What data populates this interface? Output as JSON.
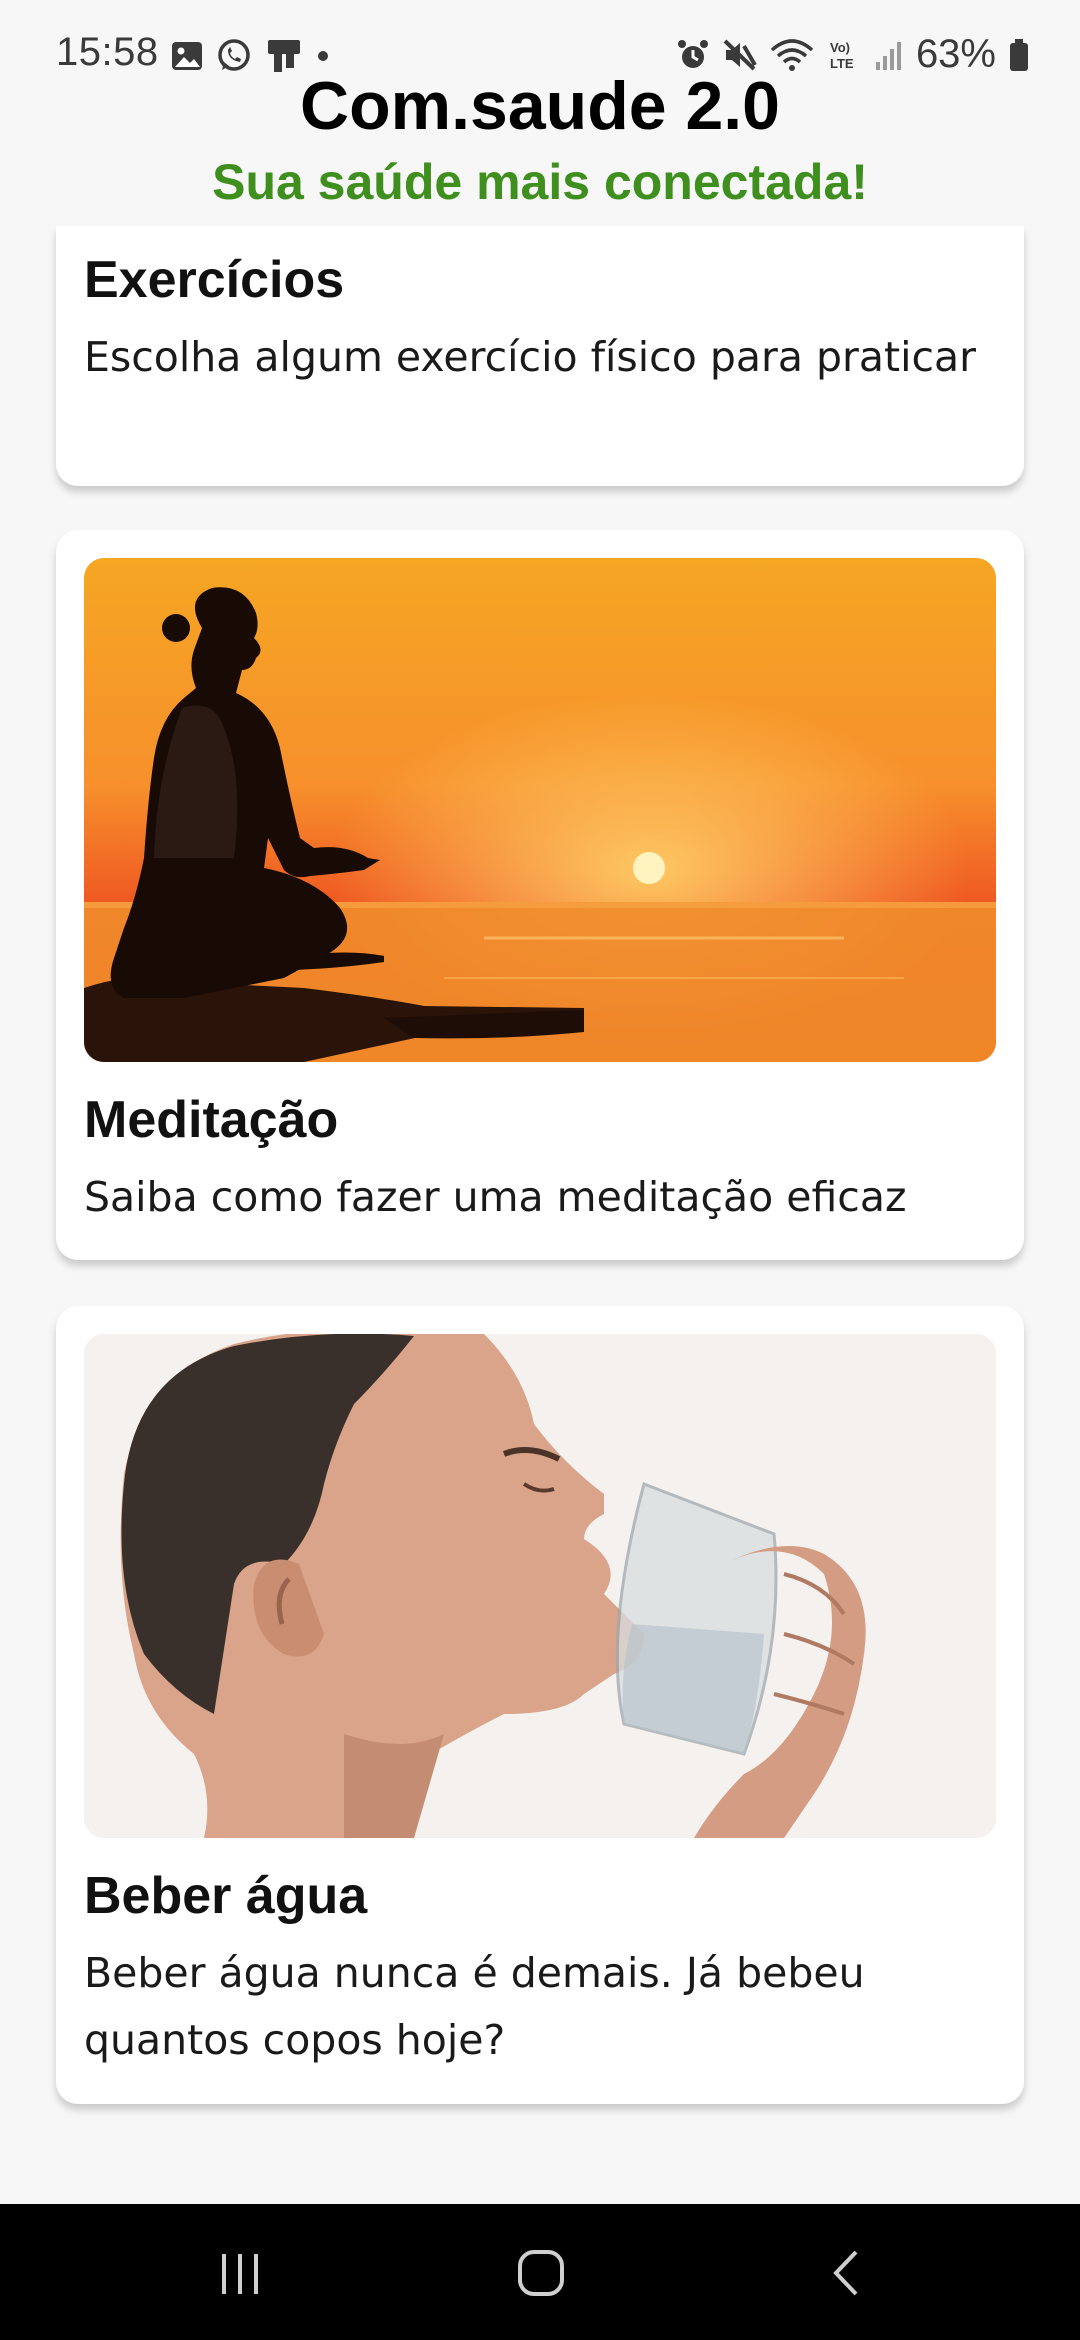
{
  "status": {
    "time": "15:58",
    "battery": "63%",
    "left_icons": [
      "image-icon",
      "whatsapp-icon",
      "sim-icon",
      "dot-icon"
    ],
    "right_icons": [
      "alarm-icon",
      "mute-icon",
      "wifi-icon",
      "volte-icon",
      "signal-icon",
      "battery-icon"
    ]
  },
  "header": {
    "title": "Com.saude 2.0",
    "subtitle": "Sua saúde mais conectada!"
  },
  "cards": [
    {
      "title": "Exercícios",
      "desc": "Escolha algum exercício físico para praticar"
    },
    {
      "title": "Meditação",
      "desc": "Saiba como fazer uma meditação eficaz",
      "image": "meditation-sunset-image"
    },
    {
      "title": "Beber água",
      "desc": "Beber água nunca é demais. Já bebeu quantos copos hoje?",
      "image": "drinking-water-image"
    }
  ],
  "nav": {
    "buttons": [
      "recents-button",
      "home-button",
      "back-button"
    ]
  },
  "colors": {
    "subtitle": "#3f8f1f",
    "background": "#f7f7f7",
    "navbar": "#000000"
  }
}
